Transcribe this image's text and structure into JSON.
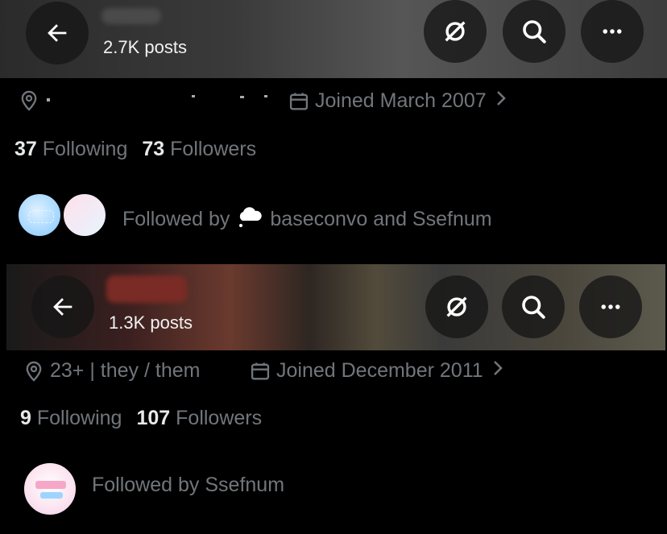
{
  "profiles": [
    {
      "posts": "2.7K posts",
      "location": "",
      "joined": "Joined March 2007",
      "following_count": "37",
      "following_label": "Following",
      "followers_count": "73",
      "followers_label": "Followers",
      "followed_by_prefix": "Followed by",
      "followed_by_names": "baseconvo and Ssefnum"
    },
    {
      "posts": "1.3K posts",
      "location": "23+ | they / them",
      "joined": "Joined December 2011",
      "following_count": "9",
      "following_label": "Following",
      "followers_count": "107",
      "followers_label": "Followers",
      "followed_by_prefix": "Followed by",
      "followed_by_names": "Ssefnum"
    }
  ],
  "icons": {
    "back": "arrow-left-icon",
    "grok": "slashed-circle-icon",
    "search": "search-icon",
    "more": "more-icon",
    "location": "location-pin-icon",
    "calendar": "calendar-icon",
    "chevron": "chevron-right-icon"
  },
  "colors": {
    "muted_text": "#71767b",
    "primary_text": "#e7e9ea",
    "background": "#000000"
  }
}
